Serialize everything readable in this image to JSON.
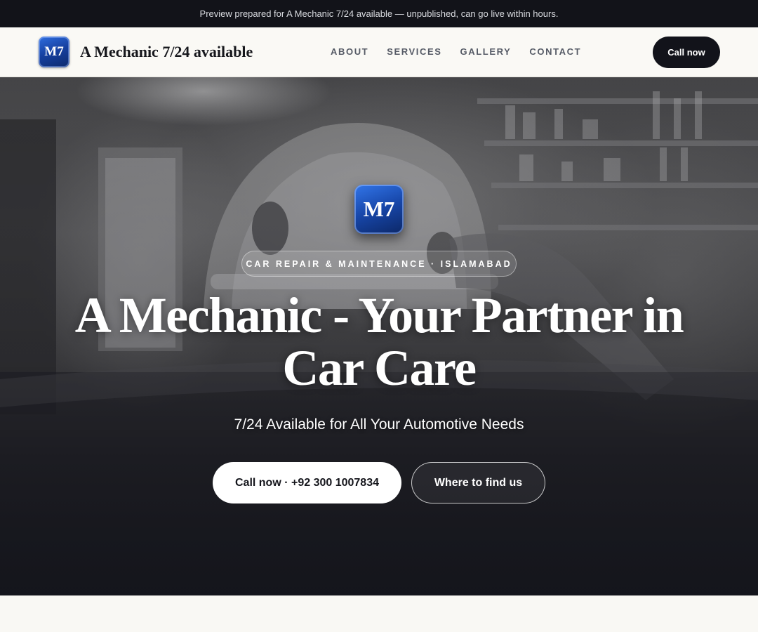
{
  "preview_bar": {
    "text": "Preview prepared for A Mechanic 7/24 available — unpublished, can go live within hours."
  },
  "nav": {
    "logo_text": "M7",
    "brand": "A Mechanic 7/24 available",
    "links": [
      "ABOUT",
      "SERVICES",
      "GALLERY",
      "CONTACT"
    ],
    "cta": "Call now"
  },
  "hero": {
    "badge_text": "M7",
    "eyebrow": "CAR REPAIR & MAINTENANCE · ISLAMABAD",
    "title": "A Mechanic - Your Partner in Car Care",
    "subtitle": "7/24 Available for All Your Automotive Needs",
    "primary_button": "Call now · +92 300 1007834",
    "secondary_button": "Where to find us",
    "background_image": "garage-photo"
  },
  "colors": {
    "dark": "#121319",
    "badge_blue": "#1746a8",
    "page_bg": "#f8f7f3"
  }
}
